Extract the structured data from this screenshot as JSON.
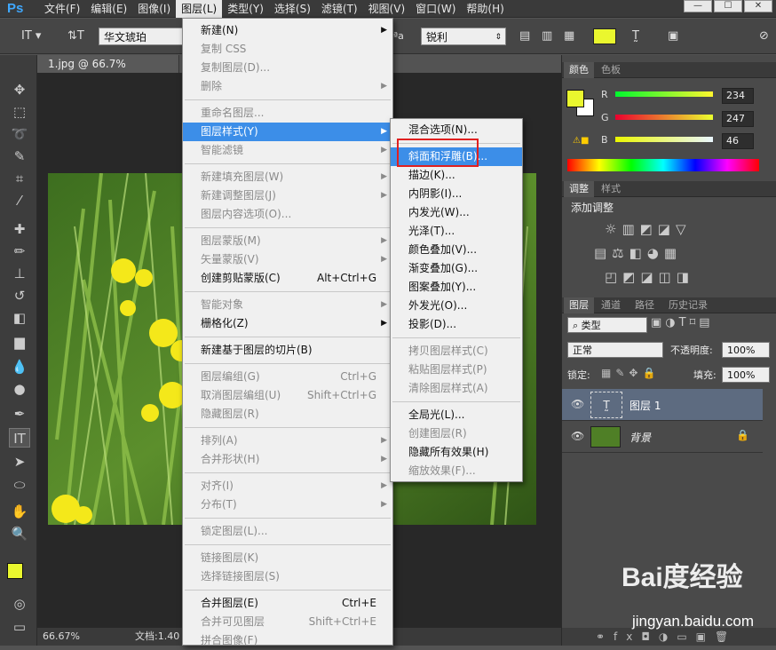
{
  "menubar": {
    "logo": "Ps",
    "items": [
      "文件(F)",
      "编辑(E)",
      "图像(I)",
      "图层(L)",
      "类型(Y)",
      "选择(S)",
      "滤镜(T)",
      "视图(V)",
      "窗口(W)",
      "帮助(H)"
    ],
    "active_index": 3
  },
  "options": {
    "font": "华文琥珀",
    "aa_label": "ªa",
    "aa_value": "锐利",
    "text_color": "#eaf72e"
  },
  "document": {
    "tab": "1.jpg @ 66.7%(RGB/8#)",
    "zoom": "66.67%",
    "doc_info": "文档:1.40"
  },
  "layer_menu": [
    {
      "label": "新建(N)",
      "arrow": true
    },
    {
      "label": "复制 CSS",
      "disabled": true
    },
    {
      "label": "复制图层(D)...",
      "disabled": true
    },
    {
      "label": "删除",
      "disabled": true,
      "arrow": true
    },
    {
      "sep": true
    },
    {
      "label": "重命名图层...",
      "disabled": true
    },
    {
      "label": "图层样式(Y)",
      "highlight": true,
      "arrow": true
    },
    {
      "label": "智能滤镜",
      "disabled": true,
      "arrow": true
    },
    {
      "sep": true
    },
    {
      "label": "新建填充图层(W)",
      "disabled": true,
      "arrow": true
    },
    {
      "label": "新建调整图层(J)",
      "disabled": true,
      "arrow": true
    },
    {
      "label": "图层内容选项(O)...",
      "disabled": true
    },
    {
      "sep": true
    },
    {
      "label": "图层蒙版(M)",
      "disabled": true,
      "arrow": true
    },
    {
      "label": "矢量蒙版(V)",
      "disabled": true,
      "arrow": true
    },
    {
      "label": "创建剪贴蒙版(C)",
      "shortcut": "Alt+Ctrl+G"
    },
    {
      "sep": true
    },
    {
      "label": "智能对象",
      "disabled": true,
      "arrow": true
    },
    {
      "label": "栅格化(Z)",
      "arrow": true
    },
    {
      "sep": true
    },
    {
      "label": "新建基于图层的切片(B)"
    },
    {
      "sep": true
    },
    {
      "label": "图层编组(G)",
      "disabled": true,
      "shortcut": "Ctrl+G"
    },
    {
      "label": "取消图层编组(U)",
      "disabled": true,
      "shortcut": "Shift+Ctrl+G"
    },
    {
      "label": "隐藏图层(R)",
      "disabled": true
    },
    {
      "sep": true
    },
    {
      "label": "排列(A)",
      "disabled": true,
      "arrow": true
    },
    {
      "label": "合并形状(H)",
      "disabled": true,
      "arrow": true
    },
    {
      "sep": true
    },
    {
      "label": "对齐(I)",
      "disabled": true,
      "arrow": true
    },
    {
      "label": "分布(T)",
      "disabled": true,
      "arrow": true
    },
    {
      "sep": true
    },
    {
      "label": "锁定图层(L)...",
      "disabled": true
    },
    {
      "sep": true
    },
    {
      "label": "链接图层(K)",
      "disabled": true
    },
    {
      "label": "选择链接图层(S)",
      "disabled": true
    },
    {
      "sep": true
    },
    {
      "label": "合并图层(E)",
      "shortcut": "Ctrl+E"
    },
    {
      "label": "合并可见图层",
      "disabled": true,
      "shortcut": "Shift+Ctrl+E"
    },
    {
      "label": "拼合图像(F)",
      "disabled": true
    }
  ],
  "style_submenu": [
    {
      "label": "混合选项(N)..."
    },
    {
      "sep": true
    },
    {
      "label": "斜面和浮雕(B)...",
      "highlight": true
    },
    {
      "label": "描边(K)..."
    },
    {
      "label": "内阴影(I)..."
    },
    {
      "label": "内发光(W)..."
    },
    {
      "label": "光泽(T)..."
    },
    {
      "label": "颜色叠加(V)..."
    },
    {
      "label": "渐变叠加(G)..."
    },
    {
      "label": "图案叠加(Y)..."
    },
    {
      "label": "外发光(O)..."
    },
    {
      "label": "投影(D)..."
    },
    {
      "sep": true
    },
    {
      "label": "拷贝图层样式(C)",
      "disabled": true
    },
    {
      "label": "粘贴图层样式(P)",
      "disabled": true
    },
    {
      "label": "清除图层样式(A)",
      "disabled": true
    },
    {
      "sep": true
    },
    {
      "label": "全局光(L)..."
    },
    {
      "label": "创建图层(R)",
      "disabled": true
    },
    {
      "label": "隐藏所有效果(H)"
    },
    {
      "label": "缩放效果(F)...",
      "disabled": true
    }
  ],
  "color_panel": {
    "tabs": [
      "颜色",
      "色板"
    ],
    "r": "234",
    "g": "247",
    "b": "46",
    "r_label": "R",
    "g_label": "G",
    "b_label": "B",
    "fg": "#eaf72e"
  },
  "adjust_panel": {
    "tabs": [
      "调整",
      "样式"
    ],
    "title": "添加调整"
  },
  "layers_panel": {
    "tabs": [
      "图层",
      "通道",
      "路径",
      "历史记录"
    ],
    "filter": "类型",
    "blend": "正常",
    "opacity_label": "不透明度:",
    "opacity": "100%",
    "lock_label": "锁定:",
    "fill_label": "填充:",
    "fill": "100%",
    "layers": [
      "图层 1",
      "背景"
    ]
  },
  "watermark": {
    "brand": "Bai度经验",
    "url": "jingyan.baidu.com"
  }
}
